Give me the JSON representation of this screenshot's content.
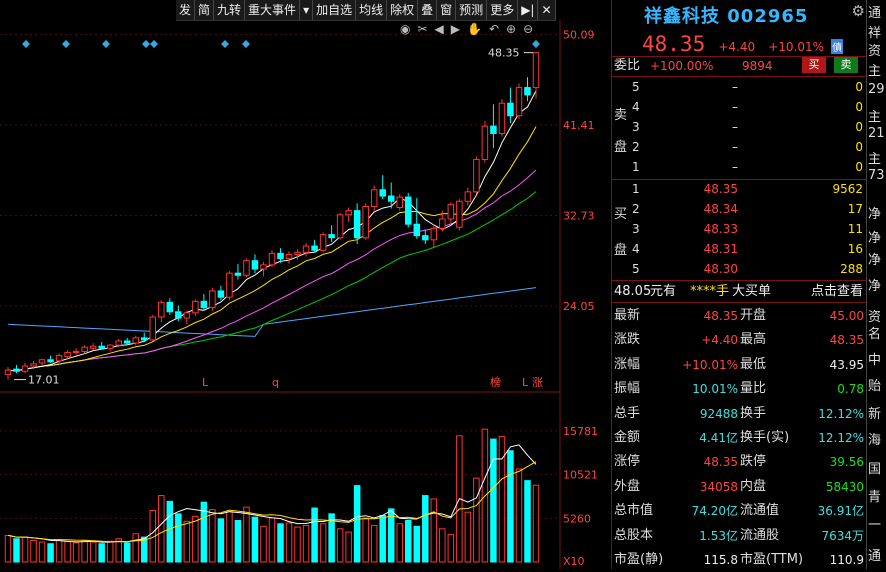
{
  "toolbar": [
    "发",
    "简",
    "九转",
    "重大事件",
    "▾",
    "加自选",
    "均线",
    "除权",
    "叠",
    "窗",
    "预测",
    "更多",
    "▶|",
    "✕"
  ],
  "chart_icons": [
    "eye-icon",
    "scissors-icon",
    "back-icon",
    "forward-icon",
    "hand-icon",
    "undo-icon",
    "zoom-in-icon",
    "zoom-out-icon"
  ],
  "price_axis": [
    "50.09",
    "41.41",
    "32.73",
    "24.05"
  ],
  "volume_axis": [
    "15781",
    "10521",
    "5260",
    "X10"
  ],
  "high_label": "48.35",
  "low_label": "17.01",
  "markers": {
    "l1": "L",
    "q": "q",
    "bang": "榜",
    "l2": "L",
    "zhang": "涨"
  },
  "chart_data": {
    "type": "candlestick",
    "yrange": [
      16,
      51
    ],
    "vol_range": [
      0,
      16500
    ],
    "candles": [
      [
        17.5,
        18.2,
        17.0,
        17.9,
        3200
      ],
      [
        18.0,
        18.4,
        17.6,
        17.8,
        2800
      ],
      [
        17.8,
        18.6,
        17.6,
        18.3,
        3000
      ],
      [
        18.3,
        18.8,
        18.0,
        18.5,
        2600
      ],
      [
        18.6,
        19.0,
        18.3,
        18.9,
        2400
      ],
      [
        18.9,
        19.3,
        18.6,
        18.7,
        2200
      ],
      [
        18.8,
        19.5,
        18.6,
        19.3,
        2700
      ],
      [
        19.2,
        19.8,
        19.0,
        19.6,
        2500
      ],
      [
        19.6,
        20.0,
        19.3,
        19.7,
        2300
      ],
      [
        19.7,
        20.3,
        19.5,
        20.1,
        2600
      ],
      [
        20.0,
        20.5,
        19.8,
        20.2,
        2400
      ],
      [
        20.2,
        20.6,
        19.9,
        20.0,
        2200
      ],
      [
        20.0,
        20.4,
        19.7,
        20.3,
        2500
      ],
      [
        20.3,
        20.9,
        20.1,
        20.7,
        2800
      ],
      [
        20.7,
        21.0,
        20.3,
        20.5,
        2300
      ],
      [
        20.5,
        21.2,
        20.3,
        21.0,
        3400
      ],
      [
        21.0,
        21.5,
        20.6,
        20.8,
        3000
      ],
      [
        20.8,
        23.2,
        20.7,
        23.0,
        6200
      ],
      [
        23.0,
        24.6,
        22.5,
        24.4,
        8000
      ],
      [
        24.4,
        24.8,
        23.2,
        23.5,
        7300
      ],
      [
        23.5,
        24.1,
        22.6,
        22.9,
        5800
      ],
      [
        22.9,
        23.6,
        22.3,
        23.4,
        4900
      ],
      [
        23.4,
        24.7,
        23.1,
        24.5,
        5500
      ],
      [
        24.5,
        25.2,
        23.6,
        23.9,
        7200
      ],
      [
        23.9,
        25.8,
        23.6,
        25.5,
        6300
      ],
      [
        25.5,
        26.0,
        24.6,
        24.9,
        5200
      ],
      [
        24.9,
        27.4,
        24.6,
        27.2,
        6100
      ],
      [
        27.2,
        28.1,
        26.6,
        27.0,
        5000
      ],
      [
        27.0,
        28.6,
        26.8,
        28.4,
        6600
      ],
      [
        28.4,
        29.0,
        27.2,
        27.6,
        5400
      ],
      [
        27.6,
        28.3,
        26.9,
        28.0,
        4300
      ],
      [
        28.0,
        29.4,
        27.8,
        29.1,
        5300
      ],
      [
        29.1,
        29.6,
        28.2,
        28.6,
        4600
      ],
      [
        28.6,
        29.3,
        28.1,
        29.0,
        4700
      ],
      [
        29.0,
        29.5,
        28.5,
        29.2,
        4200
      ],
      [
        29.2,
        30.1,
        28.8,
        29.8,
        4400
      ],
      [
        29.8,
        30.4,
        29.2,
        29.4,
        6500
      ],
      [
        29.4,
        31.1,
        29.2,
        30.9,
        4600
      ],
      [
        30.9,
        31.8,
        30.2,
        30.6,
        5800
      ],
      [
        30.6,
        33.0,
        30.4,
        32.8,
        4000
      ],
      [
        32.8,
        33.5,
        32.1,
        33.2,
        3600
      ],
      [
        33.2,
        33.9,
        30.0,
        30.6,
        9200
      ],
      [
        30.6,
        33.9,
        30.4,
        33.6,
        5300
      ],
      [
        33.6,
        35.6,
        33.1,
        35.2,
        4400
      ],
      [
        35.2,
        36.6,
        34.3,
        34.6,
        5600
      ],
      [
        34.6,
        35.9,
        33.4,
        34.1,
        6400
      ],
      [
        33.5,
        34.8,
        33.2,
        34.5,
        4600
      ],
      [
        34.5,
        34.9,
        31.6,
        31.9,
        5000
      ],
      [
        31.9,
        34.4,
        30.5,
        30.8,
        4300
      ],
      [
        30.8,
        31.4,
        30.0,
        30.4,
        8000
      ],
      [
        30.4,
        31.9,
        29.7,
        31.5,
        7600
      ],
      [
        31.5,
        33.2,
        31.2,
        32.4,
        4000
      ],
      [
        32.4,
        34.0,
        31.9,
        33.8,
        3300
      ],
      [
        31.6,
        34.3,
        31.3,
        34.1,
        15200
      ],
      [
        34.1,
        35.4,
        33.7,
        35.0,
        6000
      ],
      [
        35.0,
        38.4,
        34.8,
        38.1,
        10100
      ],
      [
        38.1,
        41.8,
        37.8,
        41.3,
        16000
      ],
      [
        41.3,
        43.4,
        39.2,
        40.6,
        14800
      ],
      [
        40.6,
        43.9,
        40.3,
        43.5,
        15100
      ],
      [
        43.5,
        45.0,
        41.6,
        42.3,
        13400
      ],
      [
        42.3,
        45.4,
        42.0,
        45.0,
        11200
      ],
      [
        45.0,
        46.0,
        43.7,
        44.3,
        9800
      ],
      [
        45.0,
        48.35,
        43.95,
        48.35,
        9248
      ]
    ]
  },
  "stock": {
    "name": "祥鑫科技",
    "code": "002965",
    "price": "48.35",
    "change": "+4.40",
    "pct": "+10.01%",
    "badge": "債"
  },
  "weibi": {
    "label": "委比",
    "pct": "+100.00%",
    "diff": "9894",
    "buy_btn": "买",
    "sell_btn": "卖"
  },
  "sell_side": {
    "l1": "卖",
    "l2": "盘",
    "rows": [
      {
        "lvl": "5",
        "price": "–",
        "vol": "0"
      },
      {
        "lvl": "4",
        "price": "–",
        "vol": "0"
      },
      {
        "lvl": "3",
        "price": "–",
        "vol": "0"
      },
      {
        "lvl": "2",
        "price": "–",
        "vol": "0"
      },
      {
        "lvl": "1",
        "price": "–",
        "vol": "0"
      }
    ]
  },
  "buy_side": {
    "l1": "买",
    "l2": "盘",
    "rows": [
      {
        "lvl": "1",
        "price": "48.35",
        "vol": "9562"
      },
      {
        "lvl": "2",
        "price": "48.34",
        "vol": "17"
      },
      {
        "lvl": "3",
        "price": "48.33",
        "vol": "11"
      },
      {
        "lvl": "4",
        "price": "48.31",
        "vol": "16"
      },
      {
        "lvl": "5",
        "price": "48.30",
        "vol": "288"
      }
    ]
  },
  "big_order": {
    "amount": "48.05",
    "unit": "元有",
    "hand": "****手",
    "desc": "大买单",
    "link": "点击查看"
  },
  "fields": [
    {
      "l1": "最新",
      "v1": "48.35",
      "c1": "red",
      "l2": "开盘",
      "v2": "45.00",
      "c2": "red"
    },
    {
      "l1": "涨跌",
      "v1": "+4.40",
      "c1": "red",
      "l2": "最高",
      "v2": "48.35",
      "c2": "red"
    },
    {
      "l1": "涨幅",
      "v1": "+10.01%",
      "c1": "red",
      "l2": "最低",
      "v2": "43.95",
      "c2": "white"
    },
    {
      "l1": "振幅",
      "v1": "10.01%",
      "c1": "cyan",
      "l2": "量比",
      "v2": "0.78",
      "c2": "green"
    },
    {
      "l1": "总手",
      "v1": "92488",
      "c1": "cyan",
      "l2": "换手",
      "v2": "12.12%",
      "c2": "cyan"
    },
    {
      "l1": "金额",
      "v1": "4.41亿",
      "c1": "cyan",
      "l2": "换手(实)",
      "v2": "12.12%",
      "c2": "cyan"
    },
    {
      "l1": "涨停",
      "v1": "48.35",
      "c1": "red",
      "l2": "跌停",
      "v2": "39.56",
      "c2": "green"
    },
    {
      "l1": "外盘",
      "v1": "34058",
      "c1": "red",
      "l2": "内盘",
      "v2": "58430",
      "c2": "green"
    },
    {
      "l1": "总市值",
      "v1": "74.20亿",
      "c1": "cyan",
      "l2": "流通值",
      "v2": "36.91亿",
      "c2": "cyan"
    },
    {
      "l1": "总股本",
      "v1": "1.53亿",
      "c1": "cyan",
      "l2": "流通股",
      "v2": "7634万",
      "c2": "cyan"
    },
    {
      "l1": "市盈(静)",
      "v1": "115.8",
      "c1": "white",
      "l2": "市盈(TTM)",
      "v2": "110.9",
      "c2": "white"
    }
  ],
  "edge": [
    "通",
    "祥",
    "资",
    "主",
    "29",
    "主",
    "21",
    "主",
    "73",
    "净",
    "净",
    "净",
    "净",
    "资",
    "名",
    "中",
    "贻",
    "新",
    "海",
    "国",
    "青",
    "一",
    "通"
  ],
  "colors": {
    "up": "#ff3232",
    "down": "#00ffff",
    "bg": "#000000",
    "ma5": "#ffffff",
    "ma10": "#ffe100",
    "ma20": "#ff55ff",
    "ma30": "#00cc00",
    "ma60": "#4fa6ff"
  }
}
